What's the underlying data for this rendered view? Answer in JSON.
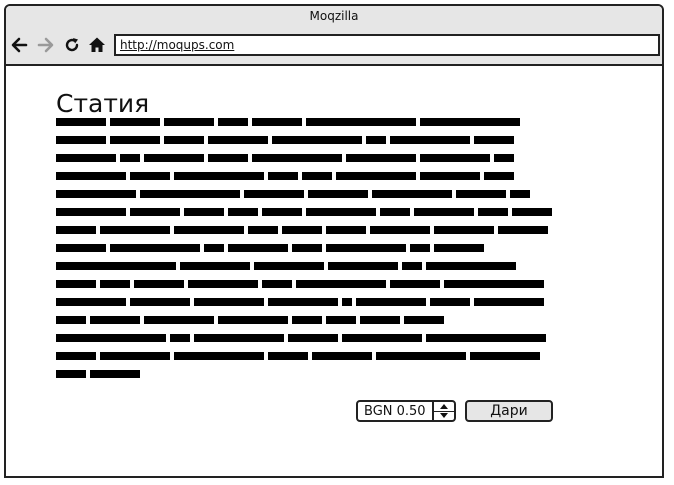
{
  "window": {
    "title": "Moqzilla"
  },
  "browser": {
    "url": "http://moqups.com",
    "back_icon": "arrow-left-icon",
    "forward_icon": "arrow-right-icon",
    "reload_icon": "reload-icon",
    "home_icon": "home-icon"
  },
  "article": {
    "title": "Статия"
  },
  "donation": {
    "amount": "BGN 0.50",
    "button_label": "Дари"
  }
}
